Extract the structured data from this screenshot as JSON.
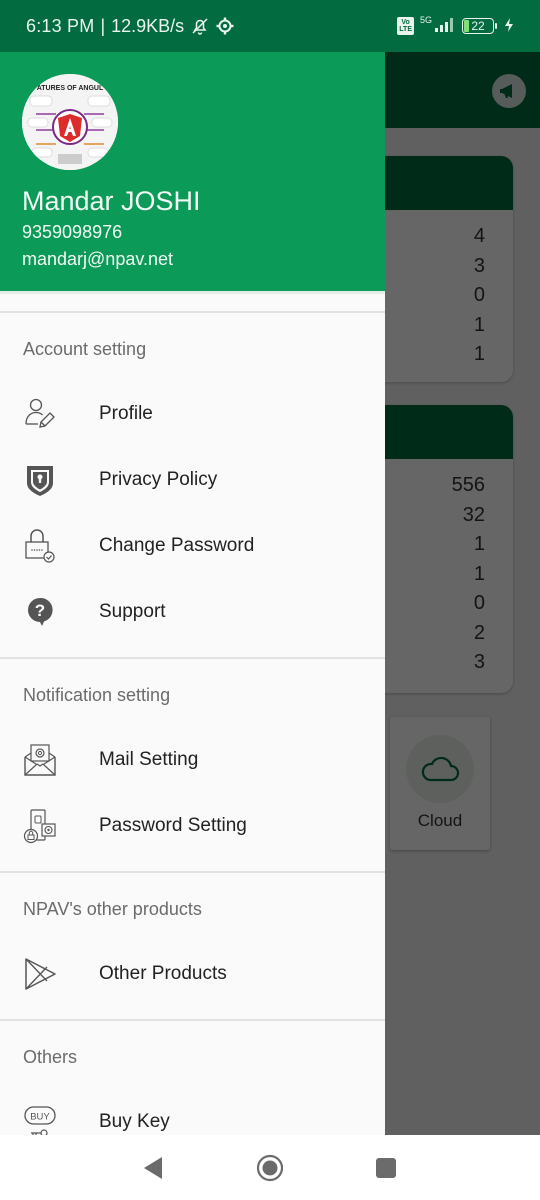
{
  "status_bar": {
    "time": "6:13 PM",
    "separator": "|",
    "network_speed": "12.9KB/s",
    "icons": [
      "bell-off-icon",
      "settings-gear-icon"
    ],
    "volte": "Vo LTE",
    "network_type": "5G",
    "battery_level": "22",
    "charging": true
  },
  "drawer": {
    "header": {
      "avatar_alt": "Features of Angular",
      "name": "Mandar JOSHI",
      "phone": "9359098976",
      "email": "mandarj@npav.net",
      "color": "#0c9a58"
    },
    "sections": [
      {
        "title": "Account setting",
        "items": [
          {
            "label": "Profile",
            "icon": "profile-edit-icon"
          },
          {
            "label": "Privacy Policy",
            "icon": "shield-keyhole-icon"
          },
          {
            "label": "Change Password",
            "icon": "padlock-check-icon"
          },
          {
            "label": "Support",
            "icon": "help-bubble-icon"
          }
        ]
      },
      {
        "title": "Notification setting",
        "items": [
          {
            "label": "Mail Setting",
            "icon": "mail-at-icon"
          },
          {
            "label": "Password Setting",
            "icon": "password-settings-icon"
          }
        ]
      },
      {
        "title": "NPAV's other products",
        "items": [
          {
            "label": "Other Products",
            "icon": "play-store-icon"
          }
        ]
      },
      {
        "title": "Others",
        "items": [
          {
            "label": "Buy Key",
            "icon": "buy-key-icon"
          }
        ]
      }
    ]
  },
  "background_app": {
    "appbar_color": "#036b40",
    "card1_values": [
      "4",
      "3",
      "0",
      "1",
      "1"
    ],
    "card2_values": [
      "556",
      "32",
      "1",
      "1",
      "0",
      "2",
      "3"
    ],
    "cloud_label": "Cloud"
  },
  "navbar": {
    "back": "back-icon",
    "home": "home-icon",
    "recents": "recents-icon"
  }
}
